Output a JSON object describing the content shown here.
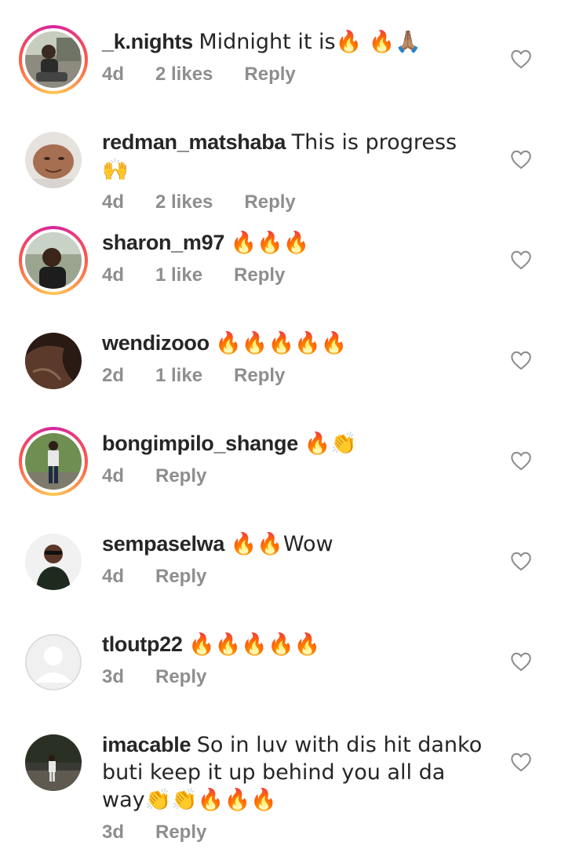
{
  "comments": [
    {
      "username": "_k.nights",
      "text": "Midnight it is🔥 🔥🙏🏽",
      "time": "4d",
      "likes": "2 likes",
      "reply": "Reply",
      "story_ring": true,
      "avatar": "photo-man-sitting"
    },
    {
      "username": "redman_matshaba",
      "text": "This is progress 🙌",
      "time": "4d",
      "likes": "2 likes",
      "reply": "Reply",
      "story_ring": false,
      "avatar": "photo-face-closeup"
    },
    {
      "username": "sharon_m97",
      "text": "🔥🔥🔥",
      "time": "4d",
      "likes": "1 like",
      "reply": "Reply",
      "story_ring": true,
      "avatar": "photo-woman-smiling"
    },
    {
      "username": "wendizooo",
      "text": "🔥🔥🔥🔥🔥",
      "time": "2d",
      "likes": "1 like",
      "reply": "Reply",
      "story_ring": false,
      "avatar": "photo-hair-closeup"
    },
    {
      "username": "bongimpilo_shange",
      "text": "🔥👏",
      "time": "4d",
      "likes": "",
      "reply": "Reply",
      "story_ring": true,
      "avatar": "photo-man-standing"
    },
    {
      "username": "sempaselwa",
      "text": "🔥🔥Wow",
      "time": "4d",
      "likes": "",
      "reply": "Reply",
      "story_ring": false,
      "avatar": "photo-woman-sunglasses"
    },
    {
      "username": "tloutp22",
      "text": "🔥🔥🔥🔥🔥",
      "time": "3d",
      "likes": "",
      "reply": "Reply",
      "story_ring": false,
      "avatar": "default-avatar"
    },
    {
      "username": "imacable",
      "text": "So in luv with dis hit danko buti keep it up behind you all da way👏👏🔥🔥🔥",
      "time": "3d",
      "likes": "",
      "reply": "Reply",
      "story_ring": false,
      "avatar": "photo-person-outdoors"
    }
  ],
  "colors": {
    "text": "#262626",
    "meta": "#8e8e8e",
    "heart": "#8e8e8e"
  }
}
